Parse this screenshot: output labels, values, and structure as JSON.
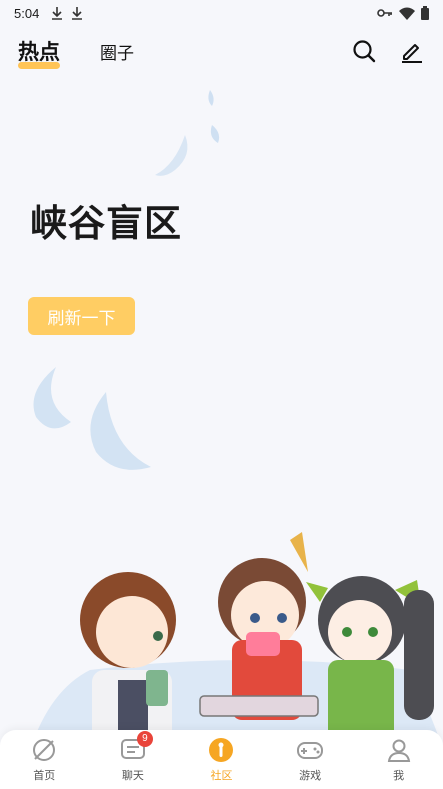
{
  "status_bar": {
    "time": "5:04"
  },
  "top_nav": {
    "tabs": [
      {
        "label": "热点",
        "active": true
      },
      {
        "label": "圈子",
        "active": false
      }
    ]
  },
  "main": {
    "title": "峡谷盲区",
    "refresh_label": "刷新一下"
  },
  "bottom_nav": {
    "items": [
      {
        "label": "首页",
        "icon": "home-icon"
      },
      {
        "label": "聊天",
        "icon": "chat-icon",
        "badge": "9"
      },
      {
        "label": "社区",
        "icon": "community-icon",
        "active": true
      },
      {
        "label": "游戏",
        "icon": "gamepad-icon"
      },
      {
        "label": "我",
        "icon": "profile-icon"
      }
    ]
  },
  "colors": {
    "accent": "#ffc456",
    "active_tab": "#f6a623",
    "badge": "#e9443a"
  }
}
